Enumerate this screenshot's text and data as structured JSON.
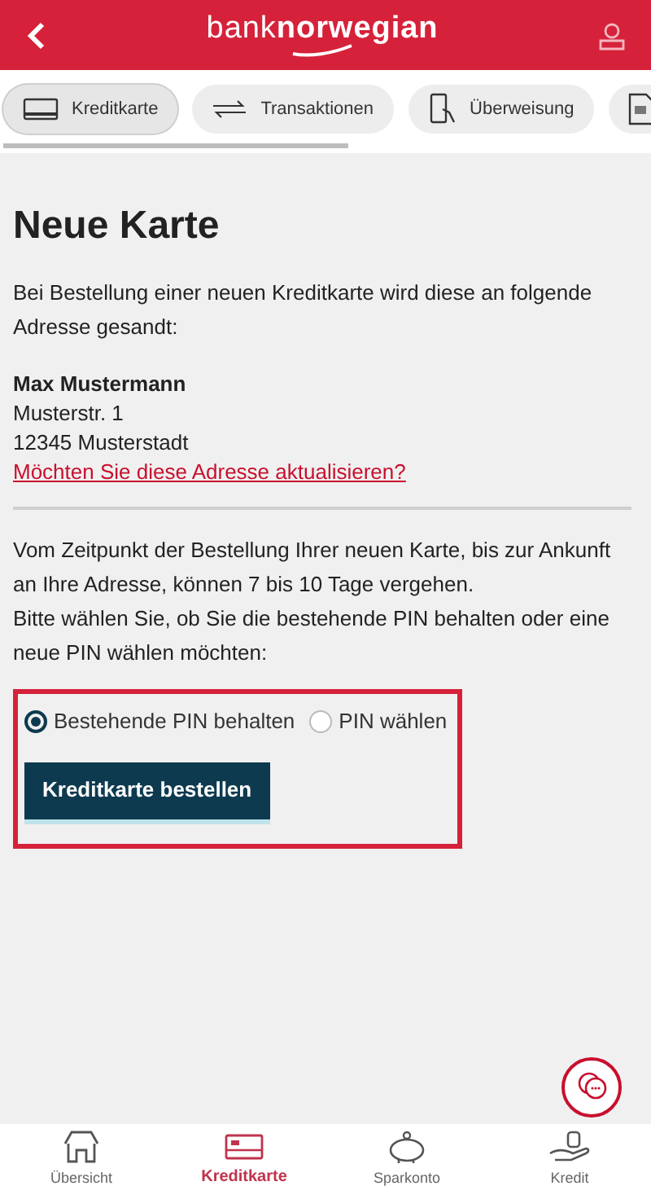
{
  "header": {
    "logo": "bank**norwegian**"
  },
  "tabs": [
    {
      "label": "Kreditkarte",
      "kind": "card",
      "selected": true
    },
    {
      "label": "Transaktionen",
      "kind": "arrows",
      "selected": false
    },
    {
      "label": "Überweisung",
      "kind": "transfer",
      "selected": false
    },
    {
      "kind": "document",
      "selected": false
    }
  ],
  "title": "Neue Karte",
  "intro": "Bei Bestellung einer neuen Kreditkarte wird diese an folgende Adresse gesandt:",
  "address": {
    "name": "Max Mustermann",
    "lines": [
      "Musterstr. 1",
      "12345 Musterstadt"
    ],
    "link": "Möchten Sie diese Adresse aktualisieren?"
  },
  "info": [
    "Vom Zeitpunkt der Bestellung Ihrer neuen Karte, bis zur Ankunft an Ihre Adresse, können 7 bis 10 Tage vergehen.",
    "Bitte wählen Sie, ob Sie die bestehende PIN behalten oder eine neue PIN wählen möchten:"
  ],
  "pin_options": [
    {
      "label": "Bestehende PIN behalten",
      "selected": true
    },
    {
      "label": "PIN wählen",
      "selected": false
    }
  ],
  "order_button": "Kreditkarte bestellen",
  "bottom_nav": [
    {
      "label": "Übersicht",
      "kind": "house",
      "selected": false
    },
    {
      "label": "Kreditkarte",
      "kind": "card",
      "selected": true
    },
    {
      "label": "Sparkonto",
      "kind": "piggy",
      "selected": false
    },
    {
      "label": "Kredit",
      "kind": "coins",
      "selected": false
    }
  ]
}
